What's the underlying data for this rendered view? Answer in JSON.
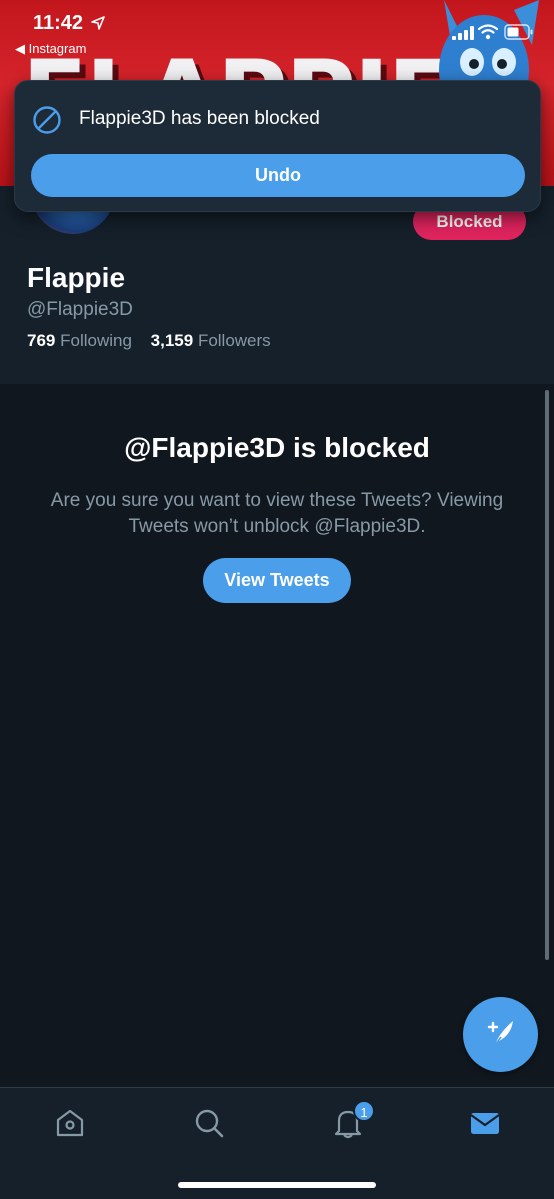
{
  "status_bar": {
    "time": "11:42",
    "back_app": "◀ Instagram"
  },
  "banner": {
    "word": "FLAPPIE"
  },
  "profile": {
    "display_name": "Flappie",
    "handle": "@Flappie3D",
    "following_count": "769",
    "following_label": "Following",
    "followers_count": "3,159",
    "followers_label": "Followers",
    "blocked_label": "Blocked"
  },
  "blocked_notice": {
    "title": "@Flappie3D is blocked",
    "description": "Are you sure you want to view these Tweets? Viewing Tweets won’t unblock @Flappie3D.",
    "view_tweets_label": "View Tweets"
  },
  "toast": {
    "message": "Flappie3D has been blocked",
    "undo_label": "Undo"
  },
  "tabbar": {
    "notifications_badge": "1"
  },
  "colors": {
    "accent": "#4a9eea",
    "blocked": "#e0245e",
    "background": "#15202b",
    "content_background": "#10171e",
    "muted_text": "#8899a6"
  },
  "icons": {
    "toast": "block-icon",
    "fab": "compose-tweet-icon",
    "tabs": [
      "home-icon",
      "search-icon",
      "bell-icon",
      "mail-icon"
    ]
  }
}
